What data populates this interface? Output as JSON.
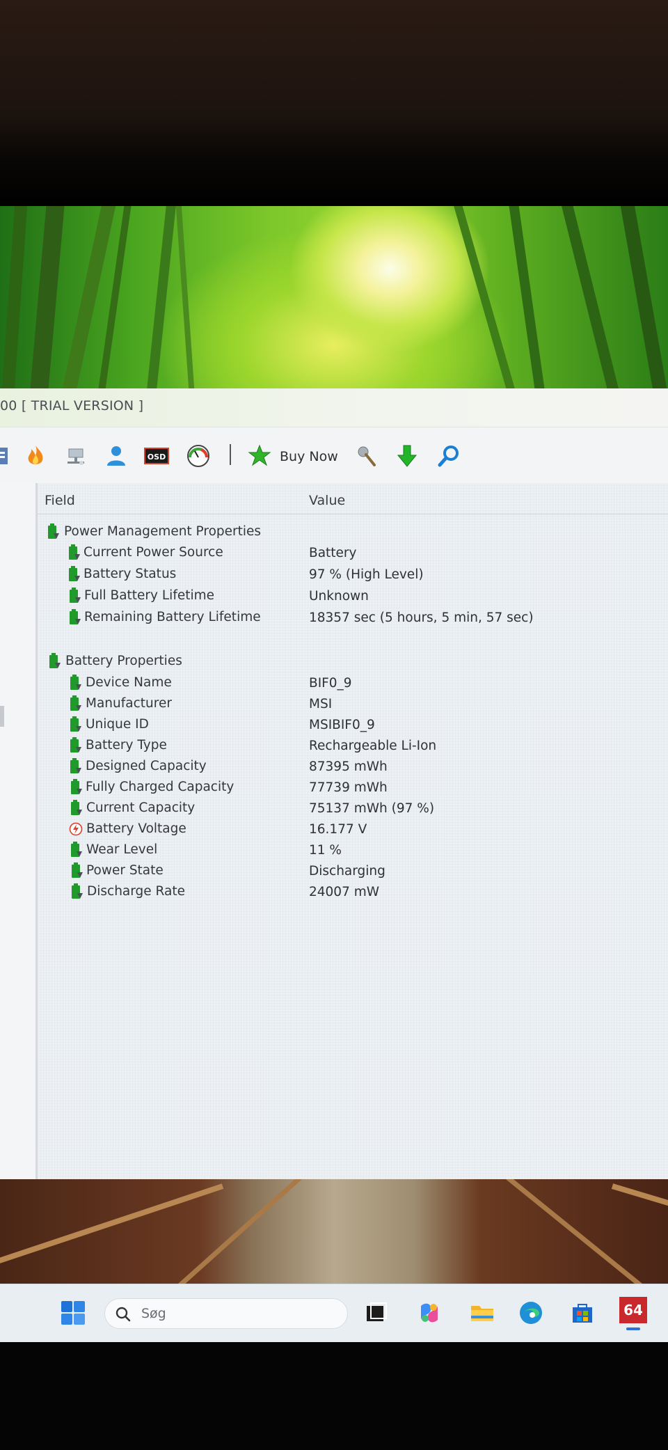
{
  "window": {
    "title": "00  [ TRIAL VERSION ]"
  },
  "toolbar": {
    "buttons": [
      "report-icon",
      "flame-icon",
      "network-icon",
      "user-icon",
      "osd-icon",
      "gauge-icon",
      "star-icon",
      "tools-icon",
      "download-icon",
      "search-icon"
    ],
    "osd_label": "OSD",
    "buy_now_label": "Buy Now"
  },
  "columns": {
    "field": "Field",
    "value": "Value"
  },
  "power_management": {
    "group_label": "Power Management Properties",
    "rows": [
      {
        "field": "Current Power Source",
        "value": "Battery"
      },
      {
        "field": "Battery Status",
        "value": "97 % (High Level)"
      },
      {
        "field": "Full Battery Lifetime",
        "value": "Unknown"
      },
      {
        "field": "Remaining Battery Lifetime",
        "value": "18357 sec (5 hours, 5 min, 57 sec)"
      }
    ]
  },
  "battery_properties": {
    "group_label": "Battery Properties",
    "rows": [
      {
        "field": "Device Name",
        "value": "BIF0_9",
        "icon": "battery-icon"
      },
      {
        "field": "Manufacturer",
        "value": "MSI",
        "icon": "battery-icon"
      },
      {
        "field": "Unique ID",
        "value": "MSIBIF0_9",
        "icon": "battery-icon"
      },
      {
        "field": "Battery Type",
        "value": "Rechargeable Li-Ion",
        "icon": "battery-icon"
      },
      {
        "field": "Designed Capacity",
        "value": "87395 mWh",
        "icon": "battery-icon"
      },
      {
        "field": "Fully Charged Capacity",
        "value": "77739 mWh",
        "icon": "battery-icon"
      },
      {
        "field": "Current Capacity",
        "value": "75137 mWh  (97 %)",
        "icon": "battery-icon"
      },
      {
        "field": "Battery Voltage",
        "value": "16.177 V",
        "icon": "voltage-icon"
      },
      {
        "field": "Wear Level",
        "value": "11 %",
        "icon": "battery-icon"
      },
      {
        "field": "Power State",
        "value": "Discharging",
        "icon": "battery-icon"
      },
      {
        "field": "Discharge Rate",
        "value": "24007 mW",
        "icon": "battery-icon"
      }
    ]
  },
  "taskbar": {
    "search_placeholder": "Søg",
    "aida_badge": "64",
    "colors": {
      "accent": "#2f6fd6",
      "badge": "#c9282c"
    }
  }
}
